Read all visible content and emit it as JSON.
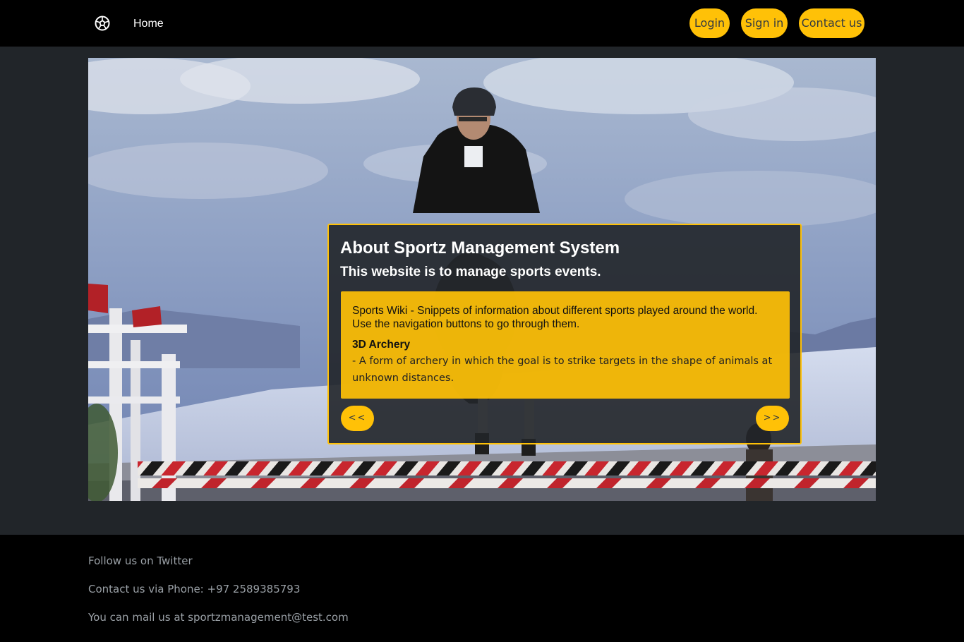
{
  "nav": {
    "logo_icon": "soccer-ball-icon",
    "home_label": "Home",
    "login_label": "Login",
    "signin_label": "Sign in",
    "contact_label": "Contact us"
  },
  "hero": {
    "image_subject": "show-jumping-horse-rider-photo"
  },
  "about": {
    "title": "About Sportz Management System",
    "subtitle": "This website is to manage sports events.",
    "wiki_intro": "Sports Wiki - Snippets of information about different sports played around the world. Use the navigation buttons to go through them.",
    "sport_name": "3D Archery",
    "sport_description": "- A form of archery in which the goal is to strike targets in the shape of animals at unknown distances.",
    "prev_label": "<<",
    "next_label": ">>"
  },
  "footer": {
    "twitter": "Follow us on Twitter",
    "phone": "Contact us via Phone: +97 2589385793",
    "email": "You can mail us at sportzmanagement@test.com"
  },
  "colors": {
    "accent": "#ffc107",
    "navbar_bg": "#000000",
    "page_bg": "#212529",
    "card_bg": "#212529"
  }
}
